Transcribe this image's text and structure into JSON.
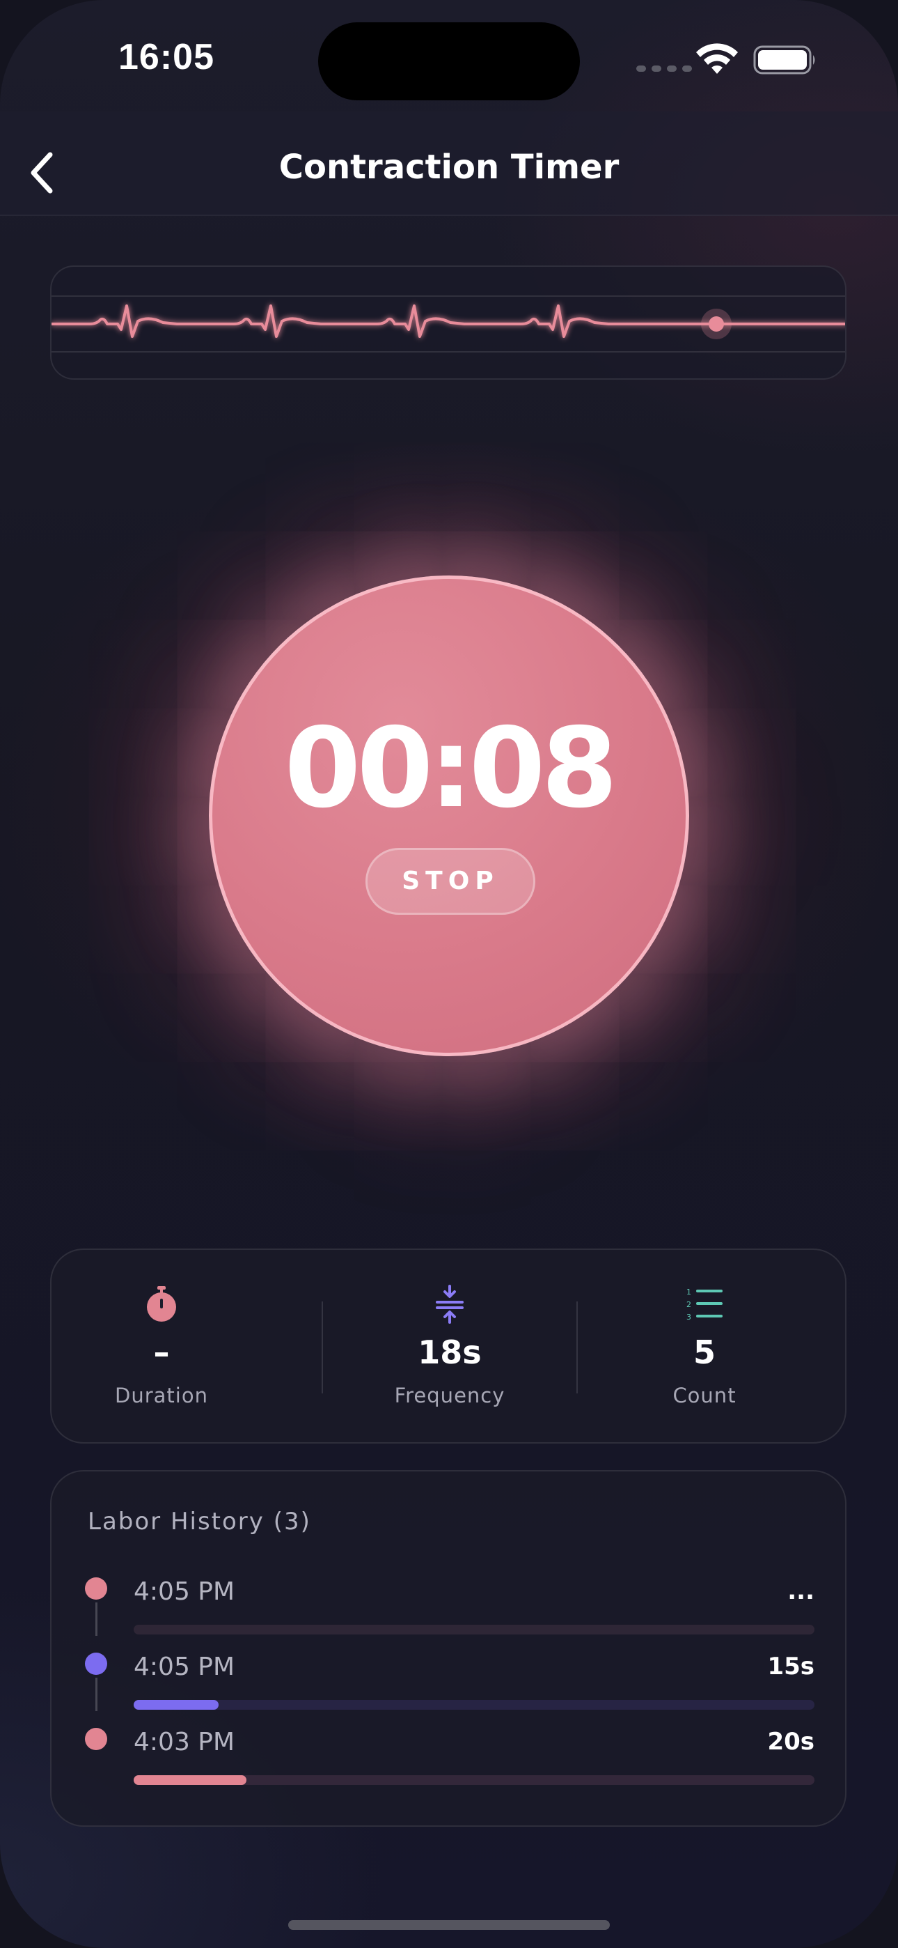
{
  "status_bar": {
    "time": "16:05",
    "icons": [
      "cellular-dots-icon",
      "wifi-icon",
      "battery-icon"
    ]
  },
  "nav": {
    "back_icon": "chevron-left-icon",
    "title": "Contraction Timer"
  },
  "timer": {
    "value": "00:08",
    "stop_label": "STOP",
    "accent_color": "#d97a8a"
  },
  "stats": [
    {
      "icon": "stopwatch-icon",
      "value": "–",
      "label": "Duration",
      "color": "#e28592"
    },
    {
      "icon": "compress-icon",
      "value": "18s",
      "label": "Frequency",
      "color": "#8b7cf6"
    },
    {
      "icon": "numbered-list-icon",
      "value": "5",
      "label": "Count",
      "color": "#5ec8b4"
    }
  ],
  "history": {
    "title": "Labor History (3)",
    "items": [
      {
        "time": "4:05 PM",
        "duration": "...",
        "color": "#e28592",
        "track_color": "#2e2636",
        "fraction": 0.0
      },
      {
        "time": "4:05 PM",
        "duration": "15s",
        "color": "#7c6cf0",
        "track_color": "#272444",
        "fraction": 0.125
      },
      {
        "time": "4:03 PM",
        "duration": "20s",
        "color": "#e28592",
        "track_color": "#33273a",
        "fraction": 0.166
      }
    ]
  }
}
